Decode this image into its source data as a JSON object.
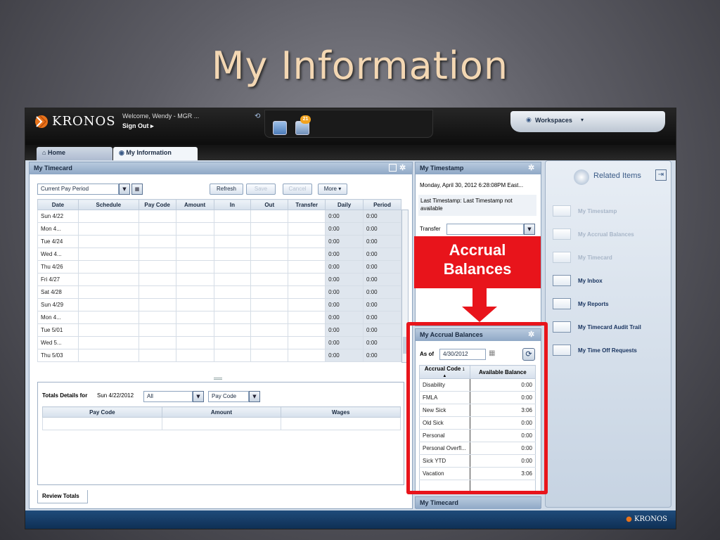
{
  "slide": {
    "title": "My Information"
  },
  "app": {
    "brand": "KRONOS",
    "welcome": "Welcome, Wendy - MGR ...",
    "sign_out": "Sign Out ▸",
    "inbox_badge": "21",
    "workspaces": "Workspaces",
    "tabs": [
      {
        "label": "Home",
        "icon": "home-icon"
      },
      {
        "label": "My Information",
        "icon": "globe-icon"
      }
    ],
    "footer_brand": "KRONOS"
  },
  "timecard": {
    "title": "My Timecard",
    "period_select": "Current Pay Period",
    "buttons": {
      "refresh": "Refresh",
      "save": "Save",
      "cancel": "Cancel",
      "more": "More"
    },
    "columns": [
      "Date",
      "Schedule",
      "Pay Code",
      "Amount",
      "In",
      "Out",
      "Transfer",
      "Daily",
      "Period"
    ],
    "rows": [
      {
        "date": "Sun 4/22",
        "daily": "0:00",
        "period": "0:00"
      },
      {
        "date": "Mon 4...",
        "daily": "0:00",
        "period": "0:00"
      },
      {
        "date": "Tue 4/24",
        "daily": "0:00",
        "period": "0:00"
      },
      {
        "date": "Wed 4...",
        "daily": "0:00",
        "period": "0:00"
      },
      {
        "date": "Thu 4/26",
        "daily": "0:00",
        "period": "0:00"
      },
      {
        "date": "Fri 4/27",
        "daily": "0:00",
        "period": "0:00"
      },
      {
        "date": "Sat 4/28",
        "daily": "0:00",
        "period": "0:00"
      },
      {
        "date": "Sun 4/29",
        "daily": "0:00",
        "period": "0:00"
      },
      {
        "date": "Mon 4...",
        "daily": "0:00",
        "period": "0:00"
      },
      {
        "date": "Tue 5/01",
        "daily": "0:00",
        "period": "0:00"
      },
      {
        "date": "Wed 5...",
        "daily": "0:00",
        "period": "0:00"
      },
      {
        "date": "Thu 5/03",
        "daily": "0:00",
        "period": "0:00"
      }
    ],
    "totals_label": "Totals Details for",
    "totals_date": "Sun 4/22/2012",
    "totals_filter": "All",
    "totals_paycode": "Pay Code",
    "totals_columns": [
      "Pay Code",
      "Amount",
      "Wages"
    ],
    "review_tab": "Review Totals"
  },
  "timestamp": {
    "title": "My Timestamp",
    "date_line": "Monday, April 30, 2012 6:28:08PM East...",
    "last_line": "Last Timestamp: Last Timestamp not available",
    "transfer_label": "Transfer"
  },
  "callout": {
    "line1": "Accrual",
    "line2": "Balances"
  },
  "accrual": {
    "title": "My Accrual Balances",
    "as_of_label": "As of",
    "as_of_date": "4/30/2012",
    "columns": [
      "Accrual Code",
      "Available Balance"
    ],
    "sort_indicator": "1 ▲",
    "rows": [
      {
        "code": "Disability",
        "balance": "0:00"
      },
      {
        "code": "FMLA",
        "balance": "0:00"
      },
      {
        "code": "New Sick",
        "balance": "3:06"
      },
      {
        "code": "Old Sick",
        "balance": "0:00"
      },
      {
        "code": "Personal",
        "balance": "0:00"
      },
      {
        "code": "Personal Overfl...",
        "balance": "0:00"
      },
      {
        "code": "Sick YTD",
        "balance": "0:00"
      },
      {
        "code": "Vacation",
        "balance": "3:06"
      }
    ]
  },
  "mini_timecard": {
    "title": "My Timecard"
  },
  "related": {
    "title": "Related Items",
    "items": [
      {
        "label": "My Timestamp",
        "active": false
      },
      {
        "label": "My Accrual Balances",
        "active": false
      },
      {
        "label": "My Timecard",
        "active": false
      },
      {
        "label": "My Inbox",
        "active": true
      },
      {
        "label": "My Reports",
        "active": true
      },
      {
        "label": "My Timecard Audit Trail",
        "active": true
      },
      {
        "label": "My Time Off Requests",
        "active": true
      }
    ]
  },
  "colors": {
    "accent_red": "#e8141b",
    "kronos_orange": "#e8731b",
    "header_blue": "#8fa8c6"
  }
}
